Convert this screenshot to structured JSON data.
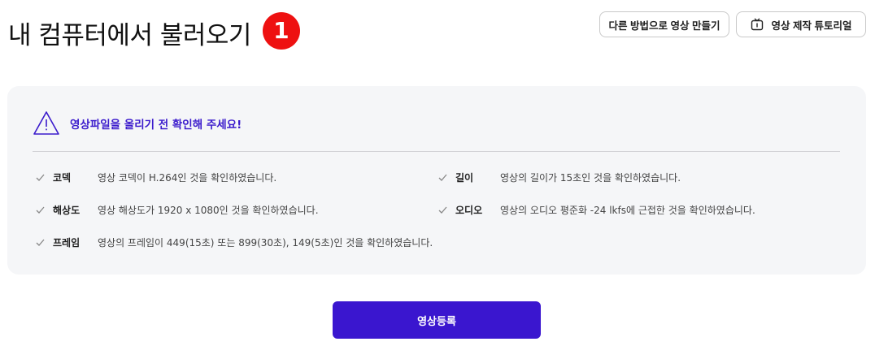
{
  "page": {
    "title": "내 컴퓨터에서 불러오기",
    "step_number": "1"
  },
  "header_buttons": {
    "other_methods": "다른 방법으로 영상 만들기",
    "tutorial": "영상 제작 튜토리얼"
  },
  "notice": {
    "text": "영상파일을 올리기 전 확인해 주세요!"
  },
  "checklist": {
    "codec": {
      "label": "코덱",
      "text": "영상 코덱이 H.264인 것을 확인하였습니다."
    },
    "length": {
      "label": "길이",
      "text": "영상의 길이가 15초인 것을 확인하였습니다."
    },
    "resolution": {
      "label": "해상도",
      "text": "영상 해상도가 1920 x 1080인 것을 확인하였습니다."
    },
    "audio": {
      "label": "오디오",
      "text": "영상의 오디오 평준화 -24 lkfs에 근접한 것을 확인하였습니다."
    },
    "frame": {
      "label": "프레임",
      "text": "영상의 프레임이 449(15초) 또는 899(30초), 149(5초)인 것을 확인하였습니다."
    }
  },
  "submit_button": "영상등록",
  "colors": {
    "accent": "#3a16cf",
    "notice_text": "#3b1bcc",
    "step_badge": "#ee1111",
    "panel_bg": "#f5f6f8"
  },
  "icons": {
    "warning": "warning-triangle-icon",
    "tutorial": "tv-icon",
    "check": "check-icon"
  }
}
